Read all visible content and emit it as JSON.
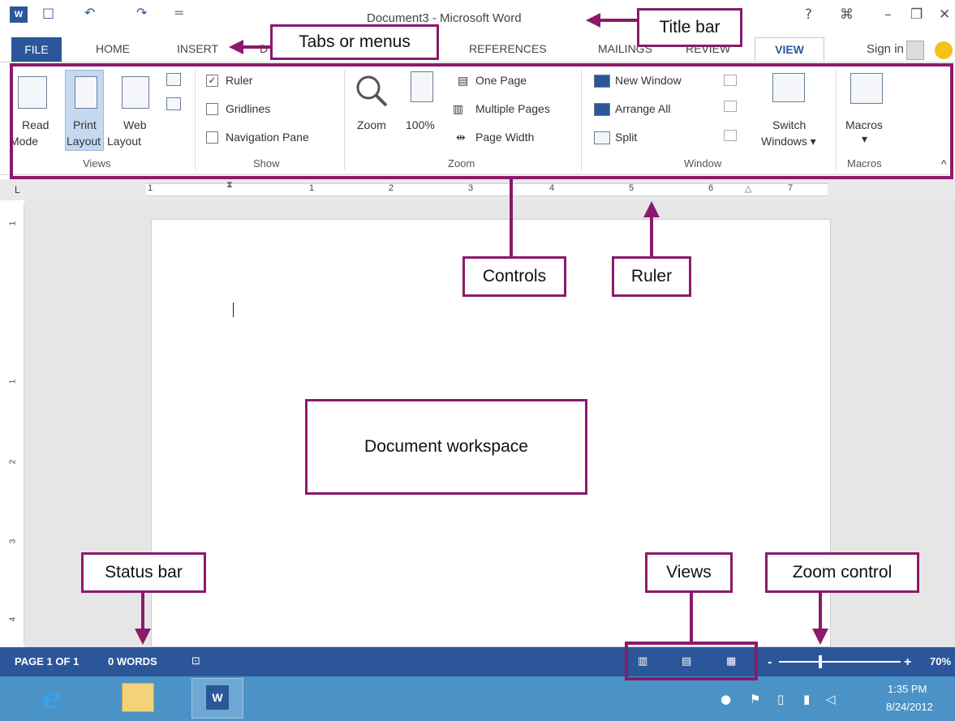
{
  "titlebar": {
    "doc_title": "Document3 - Microsoft Word",
    "qat_save": "□",
    "qat_undo": "↶",
    "qat_redo": "↷",
    "qat_more": "=",
    "help": "?",
    "restore_ribbon": "⌘",
    "minimize": "–",
    "maximize": "❐",
    "close": "✕",
    "word_icon": "W"
  },
  "tabs": {
    "file": "FILE",
    "home": "HOME",
    "insert": "INSERT",
    "design": "D",
    "references": "REFERENCES",
    "mailings": "MAILINGS",
    "review": "REVIEW",
    "view": "VIEW",
    "sign_in": "Sign in"
  },
  "ribbon": {
    "views": {
      "group_label": "Views",
      "read_mode": [
        "Read",
        "Mode"
      ],
      "print_layout": [
        "Print",
        "Layout"
      ],
      "web_layout": [
        "Web",
        "Layout"
      ]
    },
    "show": {
      "group_label": "Show",
      "ruler": "Ruler",
      "gridlines": "Gridlines",
      "navigation_pane": "Navigation Pane"
    },
    "zoom": {
      "group_label": "Zoom",
      "zoom": "Zoom",
      "hundred": "100%",
      "one_page": "One Page",
      "multiple_pages": "Multiple Pages",
      "page_width": "Page Width"
    },
    "window": {
      "group_label": "Window",
      "new_window": "New Window",
      "arrange_all": "Arrange All",
      "split": "Split",
      "switch": [
        "Switch",
        "Windows ▾"
      ]
    },
    "macros": {
      "group_label": "Macros",
      "macros": "Macros",
      "dropdown": "▾"
    },
    "collapse": "^"
  },
  "ruler": {
    "tab_selector": "L",
    "marks": [
      "1",
      "1",
      "2",
      "3",
      "4",
      "5",
      "6",
      "7"
    ],
    "vmarks": [
      "1",
      "1",
      "2",
      "3",
      "4"
    ]
  },
  "status": {
    "page": "PAGE 1 OF 1",
    "words": "0 WORDS",
    "zoom_minus": "-",
    "zoom_plus": "+",
    "zoom_level": "70%"
  },
  "taskbar": {
    "time": "1:35 PM",
    "date": "8/24/2012"
  },
  "callouts": {
    "title_bar": "Title bar",
    "tabs_or_menus": "Tabs or menus",
    "controls": "Controls",
    "ruler": "Ruler",
    "document_workspace": "Document workspace",
    "status_bar": "Status bar",
    "views": "Views",
    "zoom_control": "Zoom control"
  },
  "colors": {
    "accent": "#2b579a",
    "callout": "#8b1a6b",
    "taskbar": "#4b93c7"
  }
}
